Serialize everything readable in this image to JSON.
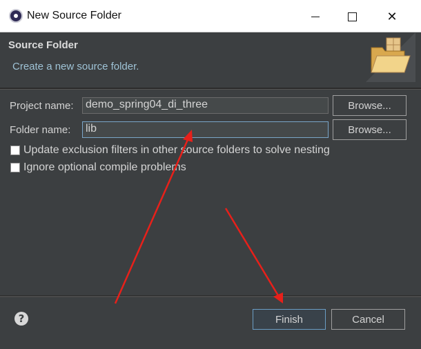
{
  "window": {
    "title": "New Source Folder"
  },
  "header": {
    "title": "Source Folder",
    "description": "Create a new source folder."
  },
  "form": {
    "project_label": "Project name:",
    "project_value": "demo_spring04_di_three",
    "project_browse": "Browse...",
    "folder_label": "Folder name:",
    "folder_value": "lib",
    "folder_browse": "Browse...",
    "option1": "Update exclusion filters in other source folders to solve nesting",
    "option2": "Ignore optional compile problems"
  },
  "footer": {
    "help": "?",
    "finish": "Finish",
    "cancel": "Cancel"
  },
  "icons": {
    "app": "eclipse-icon",
    "banner": "folder-icon",
    "help": "help-icon",
    "minimize": "minimize-icon",
    "maximize": "maximize-icon",
    "close": "close-icon"
  },
  "colors": {
    "dialog_bg": "#3c3f41",
    "annotation": "#e8201a",
    "link_text": "#9fc3d6"
  }
}
